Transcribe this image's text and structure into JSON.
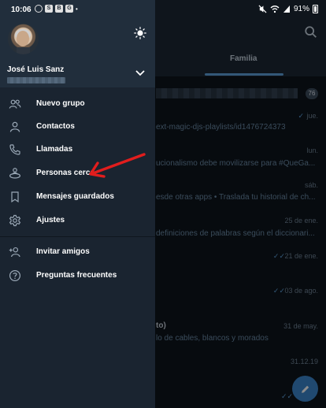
{
  "status_bar": {
    "time": "10:06",
    "left_icons": [
      "S",
      "B",
      "G"
    ],
    "battery": "91%"
  },
  "background": {
    "tab_label": "Familia",
    "unread_badge": "76",
    "chats": [
      {
        "title": "",
        "snippet": "ext-magic-djs-playlists/id1476724373",
        "date": "jue."
      },
      {
        "title": "",
        "snippet": "ucionalismo debe movilizarse para #QueGa...",
        "date": "lun."
      },
      {
        "title": "",
        "snippet": "esde otras apps • Traslada tu historial de ch...",
        "date": "sáb."
      },
      {
        "title": "",
        "snippet": "definiciones de palabras según el diccionari...",
        "date": "25 de ene."
      },
      {
        "title": "",
        "snippet": "",
        "date": "21 de ene."
      },
      {
        "title": "",
        "snippet": "",
        "date": "03 de ago."
      },
      {
        "title": "to)",
        "snippet": "lo de cables, blancos y morados",
        "date": "31 de may."
      },
      {
        "title": "",
        "snippet": "",
        "date": "31.12.19"
      }
    ]
  },
  "drawer": {
    "user_name": "José Luis Sanz",
    "menu": [
      {
        "label": "Nuevo grupo",
        "icon": "group-icon"
      },
      {
        "label": "Contactos",
        "icon": "contact-icon"
      },
      {
        "label": "Llamadas",
        "icon": "phone-icon"
      },
      {
        "label": "Personas cerca",
        "icon": "people-nearby-icon"
      },
      {
        "label": "Mensajes guardados",
        "icon": "bookmark-icon"
      },
      {
        "label": "Ajustes",
        "icon": "gear-icon"
      },
      {
        "label": "Invitar amigos",
        "icon": "add-person-icon"
      },
      {
        "label": "Preguntas frecuentes",
        "icon": "help-icon"
      }
    ]
  },
  "colors": {
    "drawer_bg": "#1a2430",
    "header_bg": "#212e3c",
    "accent": "#3b86cc",
    "annotation": "#e11d1d"
  }
}
